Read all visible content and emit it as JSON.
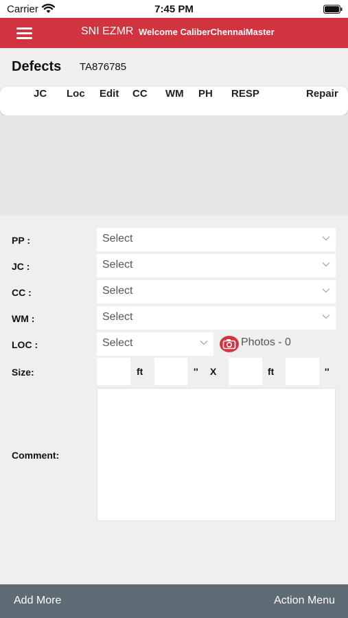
{
  "status_bar": {
    "carrier": "Carrier",
    "time": "7:45 PM"
  },
  "header": {
    "title": "SNI EZMR",
    "welcome": "Welcome CaliberChennaiMaster"
  },
  "defects": {
    "title": "Defects",
    "id": "TA876785"
  },
  "table": {
    "columns": [
      "JC",
      "Loc",
      "Edit",
      "CC",
      "WM",
      "PH",
      "RESP",
      "Repair"
    ]
  },
  "form": {
    "pp": {
      "label": "PP :",
      "value": "Select"
    },
    "jc": {
      "label": "JC :",
      "value": "Select"
    },
    "cc": {
      "label": "CC :",
      "value": "Select"
    },
    "wm": {
      "label": "WM :",
      "value": "Select"
    },
    "loc": {
      "label": "LOC :",
      "value": "Select"
    },
    "photos": {
      "label": "Photos -",
      "count": "0"
    },
    "size": {
      "label": "Size:",
      "unit_ft": "ft",
      "unit_in": "''",
      "times": "X"
    },
    "comment": {
      "label": "Comment:"
    }
  },
  "bottom_bar": {
    "add_more": "Add More",
    "action_menu": "Action Menu"
  },
  "colors": {
    "brand": "#d1343f",
    "bottom_bar": "#5f6b74"
  }
}
